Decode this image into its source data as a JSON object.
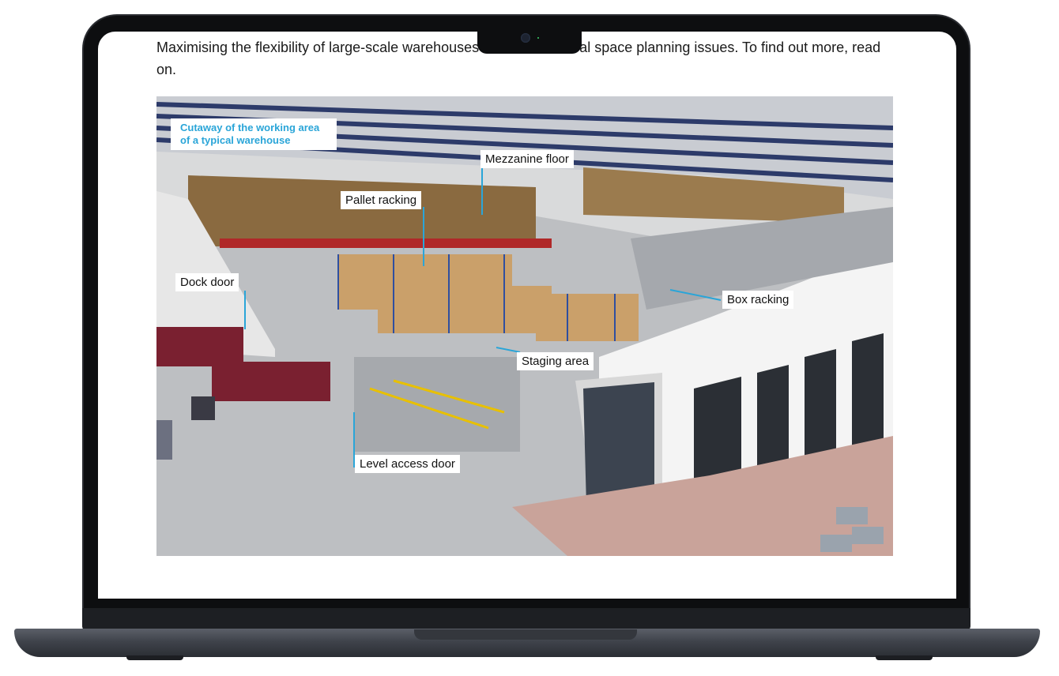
{
  "article": {
    "intro_text": "Maximising the flexibility of large-scale warehouses olution of several space planning issues. To find out more, read on."
  },
  "figure": {
    "caption_title": "Cutaway of the working area of a typical warehouse",
    "labels": {
      "mezzanine": "Mezzanine floor",
      "pallet": "Pallet racking",
      "dock": "Dock door",
      "box": "Box racking",
      "staging": "Staging area",
      "level": "Level access door"
    }
  },
  "colors": {
    "caption_accent": "#2aa5d8",
    "leader_line": "#2aa5d8",
    "truck_red": "#7a2030"
  },
  "device": {
    "type": "laptop",
    "icons": [
      "camera-icon"
    ]
  }
}
